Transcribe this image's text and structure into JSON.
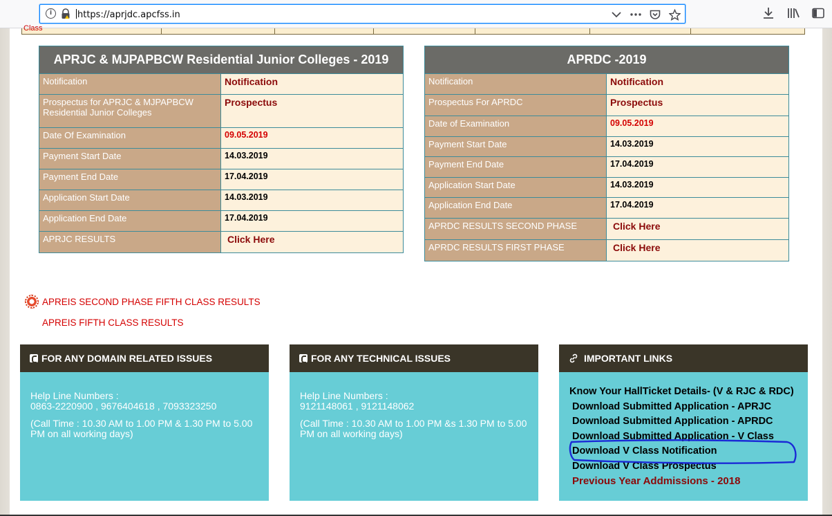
{
  "browser": {
    "url": "https://aprjdc.apcfss.in",
    "icons": [
      "info-icon",
      "lock-icon",
      "chevron-down-icon",
      "more-icon",
      "pocket-icon",
      "star-icon",
      "download-icon",
      "library-icon",
      "sidebar-icon"
    ]
  },
  "top_strip": {
    "label": "Class"
  },
  "aprjc_table": {
    "title": "APRJC & MJPAPBCW Residential Junior Colleges - 2019",
    "rows": [
      {
        "key": "Notification",
        "value": "Notification"
      },
      {
        "key": "Prospectus for APRJC & MJPAPBCW Residential Junior Colleges",
        "value": "Prospectus"
      },
      {
        "key": "Date Of Examination",
        "value": "09.05.2019"
      },
      {
        "key": "Payment Start Date",
        "value": "14.03.2019"
      },
      {
        "key": "Payment End Date",
        "value": "17.04.2019"
      },
      {
        "key": "Application Start Date",
        "value": "14.03.2019"
      },
      {
        "key": "Application End Date",
        "value": "17.04.2019"
      },
      {
        "key": "APRJC RESULTS",
        "value": "Click Here"
      }
    ]
  },
  "aprdc_table": {
    "title": "APRDC -2019",
    "rows": [
      {
        "key": "Notification",
        "value": "Notification"
      },
      {
        "key": "Prospectus For APRDC",
        "value": "Prospectus"
      },
      {
        "key": "Date of Examination",
        "value": "09.05.2019"
      },
      {
        "key": "Payment Start Date",
        "value": "14.03.2019"
      },
      {
        "key": "Payment End Date",
        "value": "17.04.2019"
      },
      {
        "key": "Application Start Date",
        "value": "14.03.2019"
      },
      {
        "key": "Application End Date",
        "value": "17.04.2019"
      },
      {
        "key": "APRDC RESULTS SECOND PHASE",
        "value": "Click Here"
      },
      {
        "key": "APRDC RESULTS FIRST PHASE",
        "value": "Click Here"
      }
    ]
  },
  "results_links": {
    "second_phase": "APREIS SECOND PHASE FIFTH CLASS RESULTS",
    "fifth_class": "APREIS FIFTH CLASS RESULTS"
  },
  "domain_panel": {
    "title": "FOR ANY DOMAIN RELATED ISSUES",
    "helpline_label": "Help Line Numbers :",
    "numbers": "0863-2220900 , 9676404618 , 7093323250",
    "call_time": "(Call Time : 10.30 AM to 1.00 PM & 1.30 PM to 5.00 PM on all working days)"
  },
  "technical_panel": {
    "title": "FOR ANY TECHNICAL ISSUES",
    "helpline_label": "Help Line Numbers :",
    "numbers": "9121148061 , 9121148062",
    "call_time": "(Call Time : 10.30 AM to 1.00 PM &s 1.30 PM to 5.00 PM on all working days)"
  },
  "links_panel": {
    "title": "IMPORTANT LINKS",
    "items": [
      "Know Your HallTicket Details- (V & RJC & RDC)",
      "Download Submitted Application - APRJC",
      "Download Submitted Application - APRDC",
      "Download Submitted Application - V Class",
      "Download V Class Notification",
      "Download V Class Prospectus",
      "Previous Year Addmissions - 2018"
    ]
  },
  "colors": {
    "table_header": "#6b6b67",
    "key_cell": "#c9a888",
    "value_cell": "#fdf1dc",
    "panel_header": "#3a3528",
    "panel_body": "#67cdd6",
    "link_red": "#8b0a0a",
    "annotation_blue": "#1a2ad6"
  }
}
